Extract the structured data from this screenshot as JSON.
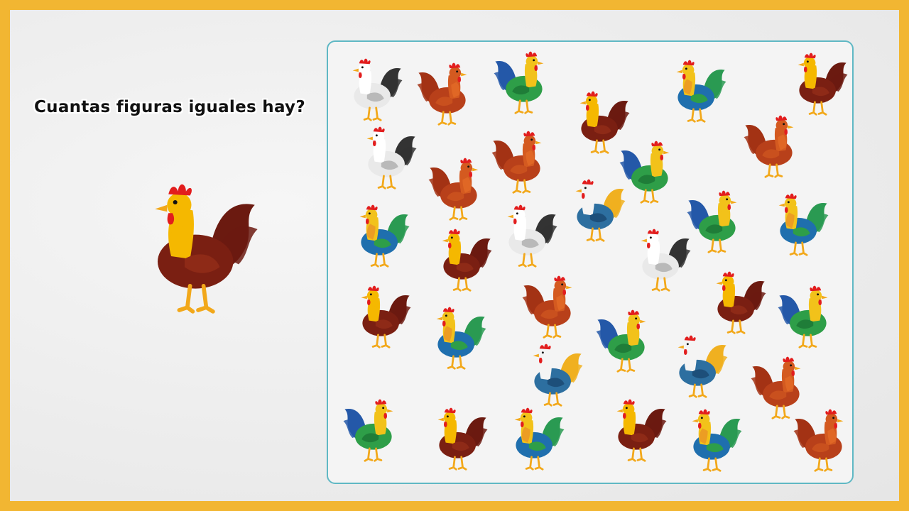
{
  "question": "Cuantas figuras iguales hay?",
  "target": {
    "variant": "brown"
  },
  "palette": {
    "frame": "#f2b632",
    "panel_border": "#5fb8c4",
    "brown": {
      "body": "#7a1f12",
      "neck": "#f5b800",
      "tail": "#6b1a10",
      "wing": "#8e2a17",
      "neck2": "#f5b800"
    },
    "orange": {
      "body": "#b8401a",
      "neck": "#d45a20",
      "tail": "#a33214",
      "wing": "#c9501e",
      "neck2": "#e8702a"
    },
    "white": {
      "body": "#e9e9e9",
      "neck": "#ffffff",
      "tail": "#333333",
      "wing": "#b9b9b9",
      "neck2": "#ffffff"
    },
    "green": {
      "body": "#2e9e48",
      "neck": "#f2c21a",
      "tail": "#2458a8",
      "wing": "#1f7d38",
      "neck2": "#f2c21a"
    },
    "multi": {
      "body": "#1f6fae",
      "neck": "#f2c21a",
      "tail": "#2a9a52",
      "wing": "#2e9e48",
      "neck2": "#e8842a"
    },
    "blue": {
      "body": "#2d6fa0",
      "neck": "#f4f4f4",
      "tail": "#f0b020",
      "wing": "#1d4f7a",
      "neck2": "#f4f4f4"
    }
  },
  "roosters": [
    {
      "variant": "white",
      "facing": "left"
    },
    {
      "variant": "orange",
      "facing": "right"
    },
    {
      "variant": "green",
      "facing": "right"
    },
    {
      "variant": "multi",
      "facing": "left"
    },
    {
      "variant": "brown",
      "facing": "left"
    },
    {
      "variant": "brown",
      "facing": "left"
    },
    {
      "variant": "orange",
      "facing": "right"
    },
    {
      "variant": "white",
      "facing": "left"
    },
    {
      "variant": "orange",
      "facing": "right"
    },
    {
      "variant": "green",
      "facing": "right"
    },
    {
      "variant": "orange",
      "facing": "right"
    },
    {
      "variant": "multi",
      "facing": "left"
    },
    {
      "variant": "brown",
      "facing": "left"
    },
    {
      "variant": "white",
      "facing": "left"
    },
    {
      "variant": "blue",
      "facing": "left"
    },
    {
      "variant": "green",
      "facing": "right"
    },
    {
      "variant": "multi",
      "facing": "left"
    },
    {
      "variant": "white",
      "facing": "left"
    },
    {
      "variant": "brown",
      "facing": "left"
    },
    {
      "variant": "multi",
      "facing": "left"
    },
    {
      "variant": "orange",
      "facing": "right"
    },
    {
      "variant": "green",
      "facing": "right"
    },
    {
      "variant": "brown",
      "facing": "left"
    },
    {
      "variant": "green",
      "facing": "right"
    },
    {
      "variant": "blue",
      "facing": "left"
    },
    {
      "variant": "blue",
      "facing": "left"
    },
    {
      "variant": "orange",
      "facing": "right"
    },
    {
      "variant": "green",
      "facing": "right"
    },
    {
      "variant": "brown",
      "facing": "left"
    },
    {
      "variant": "multi",
      "facing": "left"
    },
    {
      "variant": "brown",
      "facing": "left"
    },
    {
      "variant": "multi",
      "facing": "left"
    },
    {
      "variant": "orange",
      "facing": "right"
    }
  ]
}
